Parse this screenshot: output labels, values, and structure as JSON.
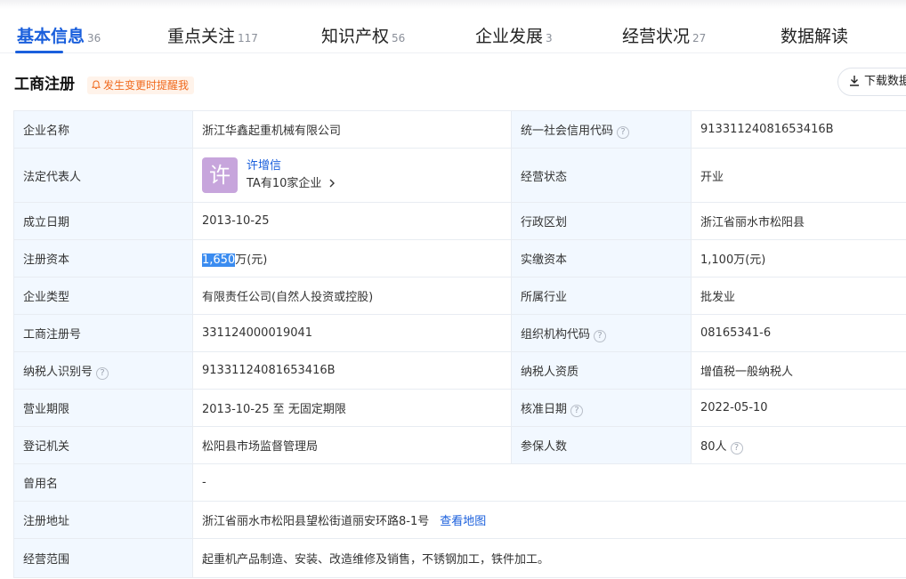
{
  "tabs": [
    {
      "label": "基本信息",
      "count": "36"
    },
    {
      "label": "重点关注",
      "count": "117"
    },
    {
      "label": "知识产权",
      "count": "56"
    },
    {
      "label": "企业发展",
      "count": "3"
    },
    {
      "label": "经营状况",
      "count": "27"
    },
    {
      "label": "数据解读",
      "count": ""
    }
  ],
  "section": {
    "title": "工商注册",
    "alert_label": "发生变更时提醒我",
    "download_label": "下载数据"
  },
  "rows": {
    "company_name": {
      "label": "企业名称",
      "value": "浙江华鑫起重机械有限公司"
    },
    "credit_code": {
      "label": "统一社会信用代码",
      "value": "91331124081653416B"
    },
    "legal_rep": {
      "label": "法定代表人",
      "avatar_char": "许",
      "name": "许增信",
      "link": "TA有10家企业"
    },
    "status": {
      "label": "经营状态",
      "value": "开业"
    },
    "founded": {
      "label": "成立日期",
      "value": "2013-10-25"
    },
    "region": {
      "label": "行政区划",
      "value": "浙江省丽水市松阳县"
    },
    "reg_capital": {
      "label": "注册资本",
      "value_highlight": "1,650",
      "value_rest": "万(元)"
    },
    "paid_capital": {
      "label": "实缴资本",
      "value": "1,100万(元)"
    },
    "company_type": {
      "label": "企业类型",
      "value": "有限责任公司(自然人投资或控股)"
    },
    "industry": {
      "label": "所属行业",
      "value": "批发业"
    },
    "reg_number": {
      "label": "工商注册号",
      "value": "331124000019041"
    },
    "org_code": {
      "label": "组织机构代码",
      "value": "08165341-6"
    },
    "taxpayer_id": {
      "label": "纳税人识别号",
      "value": "91331124081653416B"
    },
    "taxpayer_qual": {
      "label": "纳税人资质",
      "value": "增值税一般纳税人"
    },
    "term": {
      "label": "营业期限",
      "value": "2013-10-25 至 无固定期限"
    },
    "approval_date": {
      "label": "核准日期",
      "value": "2022-05-10"
    },
    "authority": {
      "label": "登记机关",
      "value": "松阳县市场监督管理局"
    },
    "insured": {
      "label": "参保人数",
      "value": "80人"
    },
    "former_name": {
      "label": "曾用名",
      "value": "-"
    },
    "address": {
      "label": "注册地址",
      "value": "浙江省丽水市松阳县望松街道丽安环路8-1号",
      "map_link": "查看地图"
    },
    "scope": {
      "label": "经营范围",
      "value": "起重机产品制造、安装、改造维修及销售，不锈钢加工，铁件加工。"
    }
  },
  "colors": {
    "accent": "#1a5fdc",
    "label_bg": "#f2f8ff",
    "alert": "#f06a1e",
    "avatar": "#c7a5dc"
  }
}
